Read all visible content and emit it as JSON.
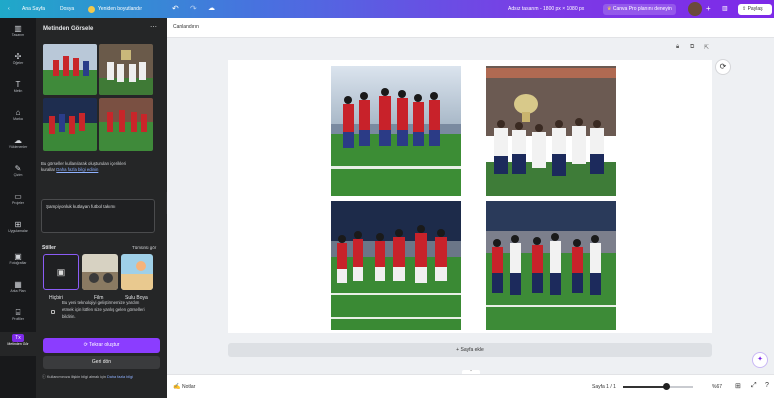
{
  "topbar": {
    "back_label": "Ana Sayfa",
    "file_label": "Dosya",
    "resize_label": "Yeniden boyutlandır",
    "undo_icon": "undo-icon",
    "redo_icon": "redo-icon",
    "cloud_icon": "cloud-save-icon",
    "doc_title": "Adsız tasarım - 1800 px × 1080 px",
    "trial_label": "Canva Pro planını deneyin",
    "share_label": "Paylaş",
    "add_icon": "plus-icon",
    "analytics_icon": "bar-chart-icon",
    "share_icon": "upload-icon",
    "accent": "#7d2ae8"
  },
  "rail": {
    "items": [
      {
        "label": "Tasarım",
        "icon": "layout-icon"
      },
      {
        "label": "Öğeler",
        "icon": "elements-icon"
      },
      {
        "label": "Metin",
        "icon": "text-icon"
      },
      {
        "label": "Marka",
        "icon": "brand-icon"
      },
      {
        "label": "Yüklenenler",
        "icon": "cloud-upload-icon"
      },
      {
        "label": "Çizim",
        "icon": "draw-icon"
      },
      {
        "label": "Projeler",
        "icon": "folder-icon"
      },
      {
        "label": "Uygulamalar",
        "icon": "apps-icon"
      },
      {
        "label": "Fotoğraflar",
        "icon": "image-icon"
      },
      {
        "label": "Arka Plan",
        "icon": "background-icon"
      },
      {
        "label": "Profiller",
        "icon": "profile-icon"
      },
      {
        "label": "Metinden Gör",
        "icon": "text-to-image-icon"
      }
    ]
  },
  "panel": {
    "title": "Metinden Görsele",
    "more_icon": "more-dots-icon",
    "disclaimer_text": "Bu görseller kullanılarak oluşturulan içerikleri",
    "disclaimer_text2": "kurallar",
    "disclaimer_link": "Daha fazla bilgi edinin",
    "prompt_value": "Şampiyonluk kutlayan futbol takımı",
    "styles_label": "Stiller",
    "see_all_label": "Tümünü gör",
    "styles": [
      {
        "label": "Hiçbiri",
        "icon": "image-placeholder-icon"
      },
      {
        "label": "Film"
      },
      {
        "label": "Sulu Boya"
      }
    ],
    "consent_text": "Bu yeni teknolojiyi geliştirmemize yardım etmek için lütfen size yanlış gelen görselleri bildirin.",
    "regenerate_label": "Tekrar oluştur",
    "back_label": "Geri dön",
    "footer_text": "Kullanımınıza ilişkin bilgi almak için",
    "footer_link": "Daha fazla bilgi"
  },
  "subtoolbar": {
    "animate_label": "Canlandırın"
  },
  "canvas": {
    "lock_icon": "lock-icon",
    "duplicate_icon": "duplicate-icon",
    "add_page_icon": "add-page-icon",
    "refresh_icon": "refresh-icon",
    "add_page_label": "+ Sayfa ekle",
    "images": [
      {
        "name": "red-team-celebrating-image",
        "desc": "red jerseys"
      },
      {
        "name": "trophy-team-image",
        "desc": "white jerseys with trophy"
      },
      {
        "name": "red-team-stadium-image",
        "desc": "red jerseys"
      },
      {
        "name": "mixed-team-image",
        "desc": "red and white jerseys"
      }
    ]
  },
  "bottombar": {
    "notes_label": "Notlar",
    "page_label": "Sayfa 1 / 1",
    "zoom_label": "%67",
    "zoom_fraction": 0.62,
    "grid_icon": "grid-view-icon",
    "fullscreen_icon": "fullscreen-icon",
    "help_icon": "help-icon",
    "magic_icon": "magic-icon"
  }
}
